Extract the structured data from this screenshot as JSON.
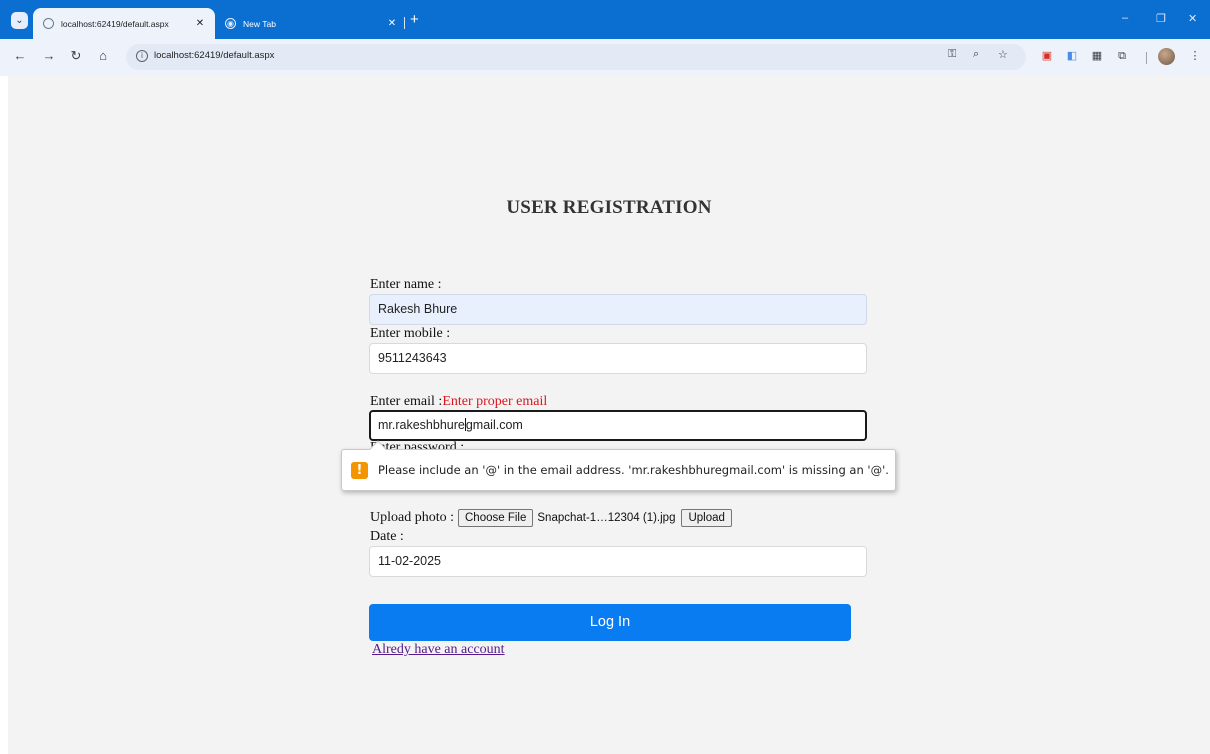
{
  "browser": {
    "tabs": [
      {
        "title": "localhost:62419/default.aspx",
        "active": true
      },
      {
        "title": "New Tab",
        "active": false
      }
    ],
    "new_tab_label": "+",
    "address": "localhost:62419/default.aspx",
    "icons": {
      "tab_menu": "chevron-down-icon",
      "back": "back-arrow-icon",
      "forward": "forward-arrow-icon",
      "reload": "reload-icon",
      "home": "home-icon",
      "site_info": "info-icon",
      "password_key": "key-icon",
      "zoom": "zoom-icon",
      "bookmark": "star-icon",
      "extensions": "puzzle-icon",
      "menu": "kebab-menu-icon"
    },
    "window_controls": {
      "minimize": "–",
      "restore": "❐",
      "close": "✕"
    },
    "colors": {
      "tab_strip": "#0a6fd0",
      "toolbar": "#eef3fb"
    }
  },
  "form": {
    "heading": "USER REGISTRATION",
    "name_label": "Enter name :",
    "name_value": "Rakesh Bhure",
    "mobile_label": "Enter mobile :",
    "mobile_value": "9511243643",
    "email_label": "Enter email :",
    "email_error": "Enter proper email",
    "email_value_before_caret": "mr.rakeshbhure",
    "email_value_after_caret": "gmail.com",
    "password_label_partial": "Enter password :",
    "upload_label": "Upload photo :",
    "choose_file_label": "Choose File",
    "file_name": "Snapchat-1…12304 (1).jpg",
    "upload_button_label": "Upload",
    "date_label": "Date :",
    "date_value": "11-02-2025",
    "submit_label": "Log In",
    "account_link": "Alredy have an account",
    "colors": {
      "button": "#0a7cf2",
      "error": "#d9161e",
      "link": "#551a8b"
    }
  },
  "validation_tooltip": {
    "icon": "warning-icon",
    "message": "Please include an '@' in the email address. 'mr.rakeshbhuregmail.com' is missing an '@'."
  }
}
